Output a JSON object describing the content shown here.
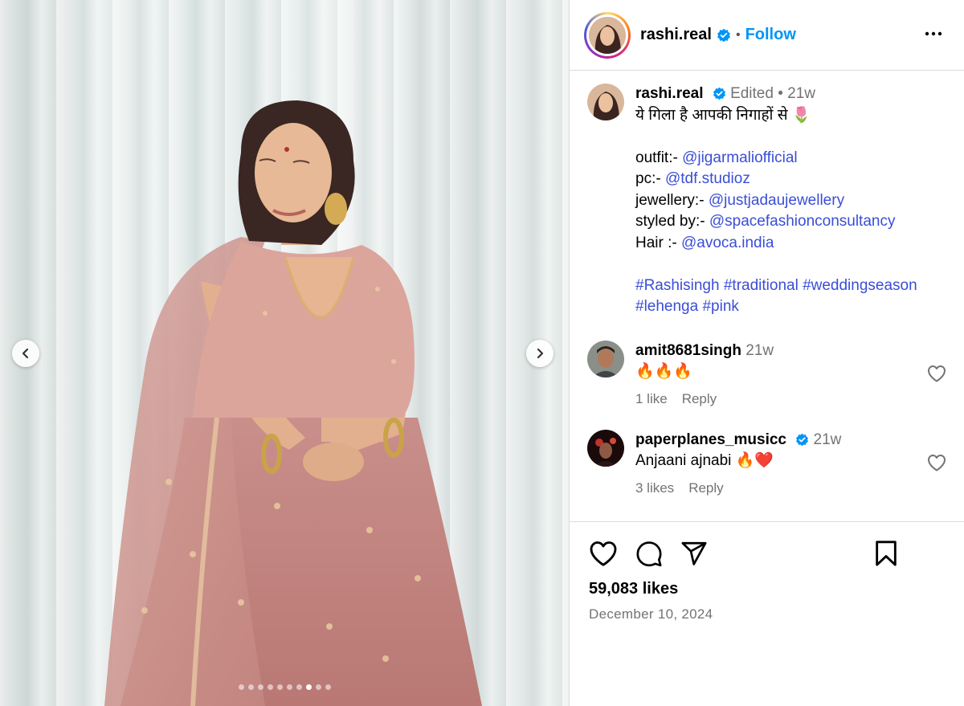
{
  "post": {
    "username": "rashi.real",
    "follow_label": "Follow",
    "separator": "•",
    "edited_label": "Edited",
    "time_ago": "21w",
    "caption_lines": [
      {
        "text": "ये गिला है आपकी निगाहों से 🌷"
      },
      {
        "text": ""
      },
      {
        "label": "outfit:- ",
        "mention": "@jigarmaliofficial"
      },
      {
        "label": "pc:- ",
        "mention": "@tdf.studioz"
      },
      {
        "label": "jewellery:- ",
        "mention": "@justjadaujewellery"
      },
      {
        "label": "styled by:- ",
        "mention": "@spacefashionconsultancy"
      },
      {
        "label": "Hair :- ",
        "mention": "@avoca.india"
      },
      {
        "text": ""
      },
      {
        "mention": "#Rashisingh #traditional #weddingseason"
      },
      {
        "mention": "#lehenga #pink"
      }
    ],
    "likes": "59,083 likes",
    "date": "December 10, 2024"
  },
  "comments": [
    {
      "username": "amit8681singh",
      "verified": false,
      "time": "21w",
      "text": "🔥🔥🔥",
      "likes": "1 like",
      "reply_label": "Reply"
    },
    {
      "username": "paperplanes_musicc",
      "verified": true,
      "time": "21w",
      "text": "Anjaani ajnabi 🔥❤️",
      "likes": "3 likes",
      "reply_label": "Reply"
    }
  ],
  "carousel": {
    "total_slides": 10,
    "active_index": 7
  },
  "colors": {
    "link": "#0095f6",
    "mention": "#3a4ed6",
    "muted": "#737373",
    "verified": "#0095f6"
  },
  "icons": [
    "heart-icon",
    "comment-icon",
    "share-icon",
    "bookmark-icon",
    "more-icon",
    "chevron-left-icon",
    "chevron-right-icon",
    "verified-badge-icon"
  ]
}
